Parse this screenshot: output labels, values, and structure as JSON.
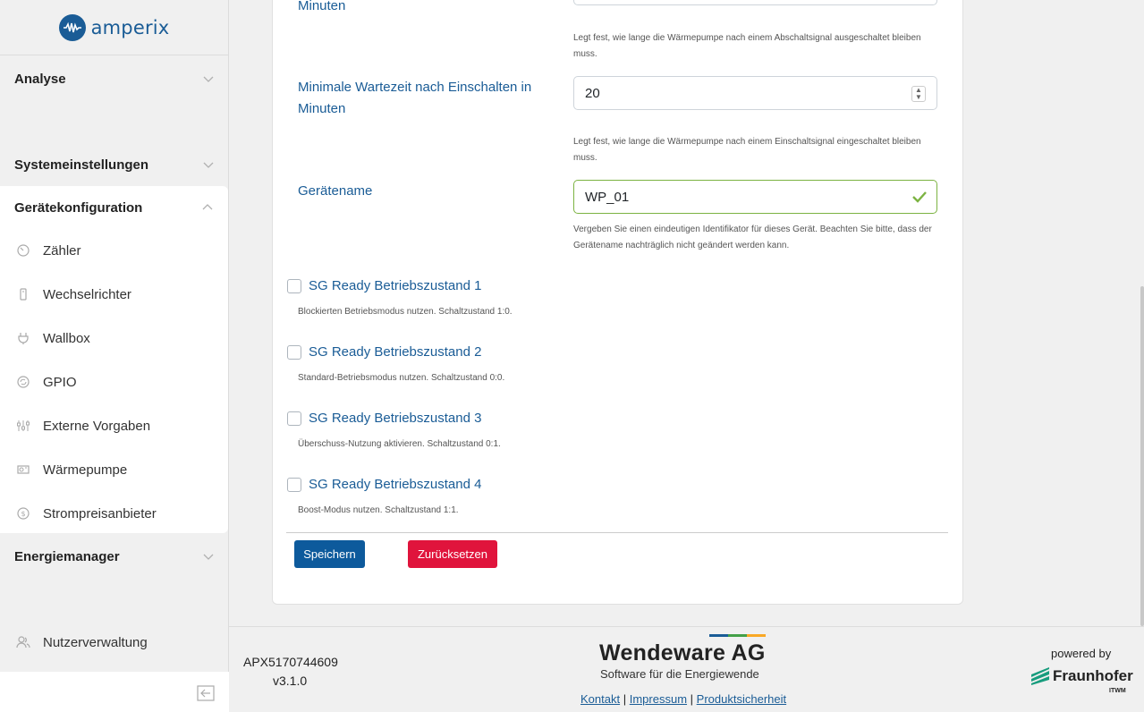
{
  "brand": {
    "name": "amperix",
    "color": "#1a5c96"
  },
  "sidebar": {
    "sections": [
      {
        "label": "Analyse"
      },
      {
        "label": "Systemeinstellungen"
      },
      {
        "label": "Gerätekonfiguration"
      },
      {
        "label": "Energiemanager"
      }
    ],
    "items": [
      {
        "label": "Zähler",
        "icon": "gauge-icon"
      },
      {
        "label": "Wechselrichter",
        "icon": "inverter-icon"
      },
      {
        "label": "Wallbox",
        "icon": "plug-icon"
      },
      {
        "label": "GPIO",
        "icon": "cycle-icon"
      },
      {
        "label": "Externe Vorgaben",
        "icon": "sliders-icon"
      },
      {
        "label": "Wärmepumpe",
        "icon": "heatpump-icon"
      },
      {
        "label": "Strompreisanbieter",
        "icon": "dollar-icon"
      }
    ],
    "user_item": {
      "label": "Nutzerverwaltung",
      "icon": "users-icon"
    }
  },
  "form": {
    "min_off_label_tail": "Minuten",
    "min_off_help": "Legt fest, wie lange die Wärmepumpe nach einem Abschaltsignal ausgeschaltet bleiben muss.",
    "min_on_label": "Minimale Wartezeit nach Einschalten in Minuten",
    "min_on_value": "20",
    "min_on_help": "Legt fest, wie lange die Wärmepumpe nach einem Einschaltsignal eingeschaltet bleiben muss.",
    "device_name_label": "Gerätename",
    "device_name_value": "WP_01",
    "device_name_help": "Vergeben Sie einen eindeutigen Identifikator für dieses Gerät. Beachten Sie bitte, dass der Gerätename nachträglich nicht geändert werden kann.",
    "checkboxes": [
      {
        "label": "SG Ready Betriebszustand 1",
        "help": "Blockierten Betriebsmodus nutzen. Schaltzustand 1:0.",
        "checked": false
      },
      {
        "label": "SG Ready Betriebszustand 2",
        "help": "Standard-Betriebsmodus nutzen. Schaltzustand 0:0.",
        "checked": false
      },
      {
        "label": "SG Ready Betriebszustand 3",
        "help": "Überschuss-Nutzung aktivieren. Schaltzustand 0:1.",
        "checked": false
      },
      {
        "label": "SG Ready Betriebszustand 4",
        "help": "Boost-Modus nutzen. Schaltzustand 1:1.",
        "checked": false
      }
    ],
    "save_label": "Speichern",
    "reset_label": "Zurücksetzen"
  },
  "footer": {
    "serial": "APX5170744609",
    "version": "v3.1.0",
    "company": "Wendeware AG",
    "tagline": "Software für die Energiewende",
    "link_contact": "Kontakt",
    "link_imprint": "Impressum",
    "link_safety": "Produktsicherheit",
    "separator": "|",
    "powered_by": "powered by",
    "partner": "Fraunhofer",
    "partner_sub": "ITWM",
    "bar_colors": [
      "#1a5c96",
      "#43a047",
      "#f9a825"
    ]
  }
}
